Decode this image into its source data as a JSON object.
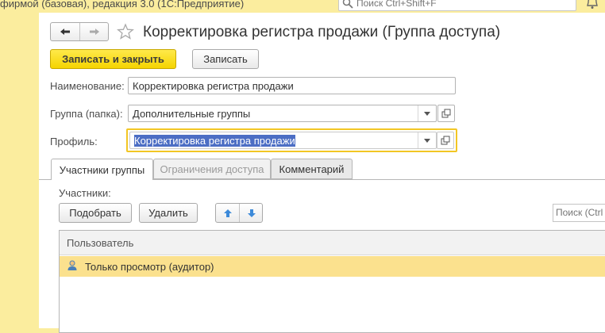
{
  "app_title": "фирмой (базовая), редакция 3.0  (1С:Предприятие)",
  "global_search": {
    "placeholder": "Поиск Ctrl+Shift+F"
  },
  "form": {
    "title": "Корректировка регистра продажи (Группа доступа)",
    "buttons": {
      "save_close": "Записать и закрыть",
      "save": "Записать"
    },
    "fields": {
      "name": {
        "label": "Наименование:",
        "value": "Корректировка регистра продажи"
      },
      "group": {
        "label": "Группа (папка):",
        "value": "Дополнительные группы"
      },
      "profile": {
        "label": "Профиль:",
        "value": "Корректировка регистра продажи"
      }
    },
    "tabs": [
      {
        "label": "Участники группы"
      },
      {
        "label": "Ограничения доступа"
      },
      {
        "label": "Комментарий"
      }
    ],
    "members": {
      "label": "Участники:",
      "pick_button": "Подобрать",
      "delete_button": "Удалить",
      "search_placeholder": "Поиск (Ctrl",
      "column_user": "Пользователь",
      "rows": [
        {
          "user": "Только просмотр (аудитор)"
        }
      ]
    }
  },
  "colors": {
    "accent": "#f5d400",
    "highlight_row": "#fbe18e",
    "selection": "#4c6ec4",
    "topbar": "#fbed9e"
  }
}
